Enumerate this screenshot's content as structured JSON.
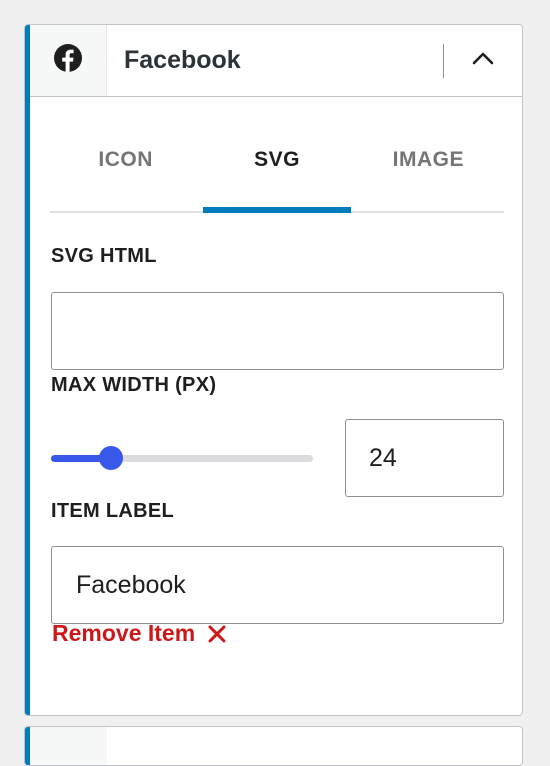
{
  "item": {
    "title": "Facebook",
    "icon": "facebook-icon",
    "toggle_icon": "chevron-up-icon"
  },
  "tabs": [
    {
      "label": "ICON",
      "active": false
    },
    {
      "label": "SVG",
      "active": true
    },
    {
      "label": "IMAGE",
      "active": false
    }
  ],
  "svg_html": {
    "label": "SVG HTML",
    "value": ""
  },
  "max_width": {
    "label": "MAX WIDTH (PX)",
    "value": "24",
    "slider_fraction": 0.23
  },
  "item_label": {
    "label": "ITEM LABEL",
    "value": "Facebook"
  },
  "remove": {
    "label": "Remove Item",
    "icon": "close-icon"
  },
  "colors": {
    "accent": "#007cba",
    "slider": "#3858e9",
    "danger": "#cc1818"
  }
}
